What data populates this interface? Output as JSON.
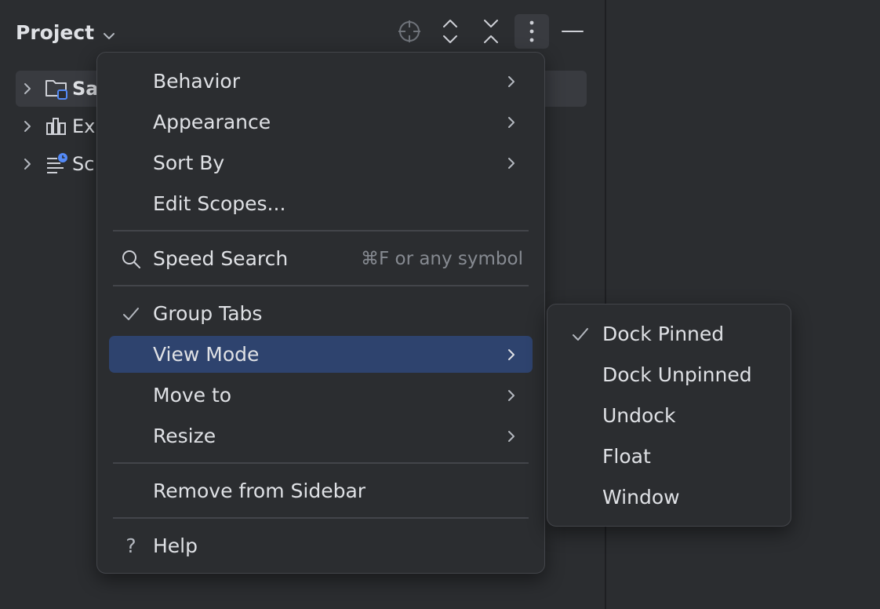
{
  "header": {
    "title": "Project"
  },
  "tree": {
    "items": [
      {
        "label": "Sa",
        "icon": "project-folder-icon",
        "selected": true
      },
      {
        "label": "Ex",
        "icon": "external-libraries-icon",
        "selected": false
      },
      {
        "label": "Sc",
        "icon": "scratches-icon",
        "selected": false
      }
    ]
  },
  "menu": {
    "behavior": "Behavior",
    "appearance": "Appearance",
    "sort_by": "Sort By",
    "edit_scopes": "Edit Scopes...",
    "speed_search": "Speed Search",
    "speed_search_shortcut": "⌘F or any symbol",
    "group_tabs": "Group Tabs",
    "view_mode": "View Mode",
    "move_to": "Move to",
    "resize": "Resize",
    "remove_from_sidebar": "Remove from Sidebar",
    "help_icon": "?",
    "help": "Help"
  },
  "submenu": {
    "dock_pinned": "Dock Pinned",
    "dock_unpinned": "Dock Unpinned",
    "undock": "Undock",
    "float": "Float",
    "window": "Window"
  },
  "colors": {
    "background": "#2b2d30",
    "highlight": "#2e436e",
    "selected_row": "#393b40",
    "text": "#dfe1e5",
    "muted_text": "#868a91"
  }
}
